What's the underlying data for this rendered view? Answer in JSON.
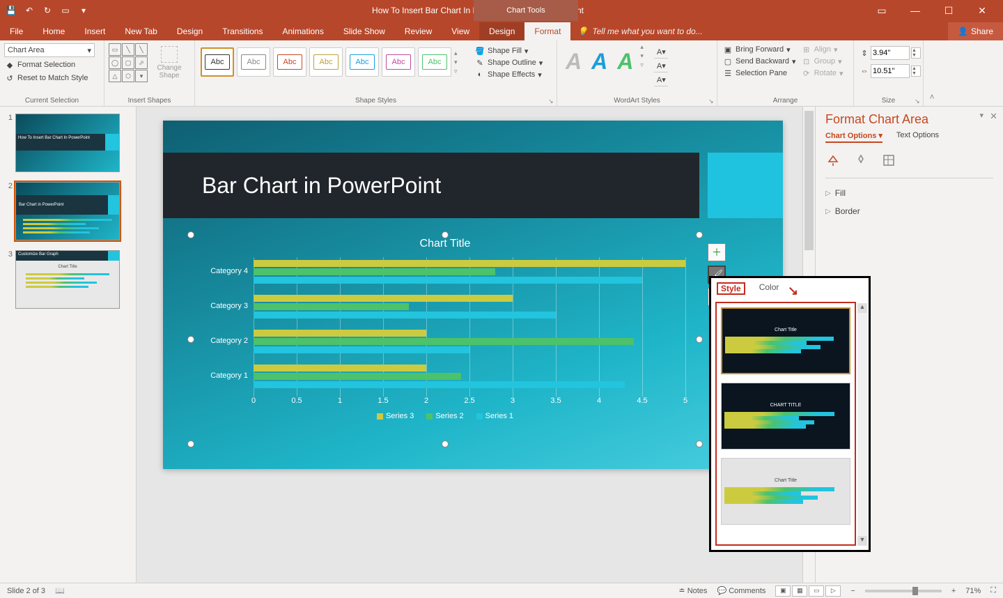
{
  "app": {
    "doc_title": "How To Insert Bar Chart In PowerPoint.pptx - PowerPoint",
    "context_title": "Chart Tools",
    "share": "Share"
  },
  "tabs": {
    "file": "File",
    "home": "Home",
    "insert": "Insert",
    "newtab": "New Tab",
    "design": "Design",
    "transitions": "Transitions",
    "animations": "Animations",
    "slideshow": "Slide Show",
    "review": "Review",
    "view": "View",
    "cdesign": "Design",
    "cformat": "Format",
    "tellme": "Tell me what you want to do..."
  },
  "ribbon": {
    "cursel": {
      "label": "Current Selection",
      "combo": "Chart Area",
      "format_sel": "Format Selection",
      "reset": "Reset to Match Style"
    },
    "shapes": {
      "label": "Insert Shapes",
      "change": "Change Shape"
    },
    "styles": {
      "label": "Shape Styles",
      "abc": "Abc",
      "fill": "Shape Fill",
      "outline": "Shape Outline",
      "effects": "Shape Effects"
    },
    "wordart": {
      "label": "WordArt Styles"
    },
    "arrange": {
      "label": "Arrange",
      "forward": "Bring Forward",
      "backward": "Send Backward",
      "selpane": "Selection Pane",
      "align": "Align",
      "group": "Group",
      "rotate": "Rotate"
    },
    "size": {
      "label": "Size",
      "h": "3.94\"",
      "w": "10.51\""
    }
  },
  "thumbs": {
    "t1": "How To Insert Bar Chart In PowerPoint",
    "t2": "Bar Chart in PowerPoint",
    "t3": "Customize Bar Graph",
    "t3sub": "Chart Title"
  },
  "slide": {
    "title": "Bar Chart in PowerPoint"
  },
  "chart_data": {
    "type": "bar",
    "orientation": "horizontal",
    "title": "Chart Title",
    "categories": [
      "Category 4",
      "Category 3",
      "Category 2",
      "Category 1"
    ],
    "series": [
      {
        "name": "Series 3",
        "color": "#cccb3f",
        "values": [
          5.0,
          3.0,
          2.0,
          2.0
        ]
      },
      {
        "name": "Series 2",
        "color": "#4cc26b",
        "values": [
          2.8,
          1.8,
          4.4,
          2.4
        ]
      },
      {
        "name": "Series 1",
        "color": "#22c4de",
        "values": [
          4.5,
          3.5,
          2.5,
          4.3
        ]
      }
    ],
    "xlim": [
      0,
      5
    ],
    "xticks": [
      0,
      0.5,
      1,
      1.5,
      2,
      2.5,
      3,
      3.5,
      4,
      4.5,
      5
    ],
    "legend": [
      "Series 3",
      "Series 2",
      "Series 1"
    ]
  },
  "flyout": {
    "style": "Style",
    "color": "Color"
  },
  "pane": {
    "title": "Format Chart Area",
    "opt": "Chart Options",
    "txt": "Text Options",
    "fill": "Fill",
    "border": "Border"
  },
  "status": {
    "slide": "Slide 2 of 3",
    "notes": "Notes",
    "comments": "Comments",
    "zoom": "71%"
  }
}
